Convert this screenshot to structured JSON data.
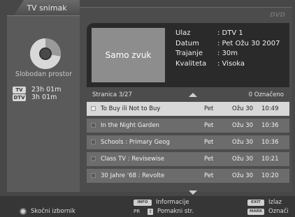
{
  "left_tab": {
    "title": "TV snimak"
  },
  "storage": {
    "free_label": "Slobodan prostor",
    "rows": [
      {
        "badge": "TV",
        "value": "23h 01m"
      },
      {
        "badge": "DTV",
        "value": "3h 01m"
      }
    ]
  },
  "logo": "DVD",
  "info": {
    "thumb_text": "Samo zvuk",
    "lines": [
      {
        "key": "Ulaz",
        "value": ": DTV 1"
      },
      {
        "key": "Datum",
        "value": ": Pet Ožu 30 2007"
      },
      {
        "key": "Trajanje",
        "value": ": 30m"
      },
      {
        "key": "Kvaliteta",
        "value": ": Visoka"
      }
    ]
  },
  "page": {
    "label": "Stranica  3/27",
    "count": "0 Označeno"
  },
  "list": [
    {
      "title": "To Buy ili Not to Buy",
      "day": "Pet",
      "date": "Ožu 30",
      "time": "10:49",
      "selected": true
    },
    {
      "title": "In the Night Garden",
      "day": "Pet",
      "date": "Ožu 30",
      "time": "10:36",
      "selected": false
    },
    {
      "title": "Schools : Primary Geog",
      "day": "Pet",
      "date": "Ožu 30",
      "time": "10:36",
      "selected": false
    },
    {
      "title": "Class TV : Revisewise",
      "day": "Pet",
      "date": "Ožu 30",
      "time": "10:21",
      "selected": false
    },
    {
      "title": "30 Jahre '68 : Revolte",
      "day": "Pet",
      "date": "Ožu 30",
      "time": "10:20",
      "selected": false
    }
  ],
  "bottom": {
    "popup_label": "Skočni izbornik",
    "info_key": "INFO",
    "info_label": "Informacije",
    "pr_key": "PR",
    "pr_label": "Pomakni str.",
    "exit_key": "EXIT",
    "exit_label": "Izlaz",
    "mark_key": "MARK",
    "mark_label": "Označi"
  }
}
